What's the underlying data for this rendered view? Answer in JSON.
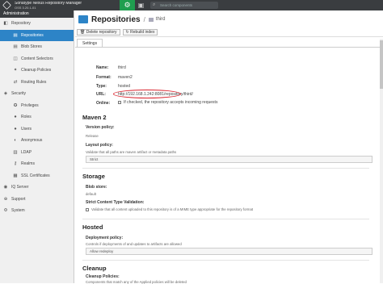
{
  "topbar": {
    "app_name": "Sonatype Nexus Repository Manager",
    "version": "OSS 3.20.1-01",
    "search_placeholder": "Search components",
    "icons": {
      "logo": "nexus-logo-icon",
      "admin": "gear-icon",
      "browse": "cube-icon",
      "search": "search-icon"
    }
  },
  "sidebar": {
    "header": "Administration",
    "items": [
      {
        "label": "Repository",
        "icon": "database-icon",
        "level": 0,
        "expander": "▾"
      },
      {
        "label": "Repositories",
        "icon": "database-icon",
        "level": 1,
        "selected": true
      },
      {
        "label": "Blob Stores",
        "icon": "database-icon",
        "level": 1
      },
      {
        "label": "Content Selectors",
        "icon": "layers-icon",
        "level": 1
      },
      {
        "label": "Cleanup Policies",
        "icon": "broom-icon",
        "level": 1
      },
      {
        "label": "Routing Rules",
        "icon": "route-icon",
        "level": 1
      },
      {
        "label": "Security",
        "icon": "shield-icon",
        "level": 0,
        "expander": "▾"
      },
      {
        "label": "Privileges",
        "icon": "badge-icon",
        "level": 1
      },
      {
        "label": "Roles",
        "icon": "user-role-icon",
        "level": 1
      },
      {
        "label": "Users",
        "icon": "users-icon",
        "level": 1
      },
      {
        "label": "Anonymous",
        "icon": "user-secret-icon",
        "level": 1
      },
      {
        "label": "LDAP",
        "icon": "book-icon",
        "level": 1
      },
      {
        "label": "Realms",
        "icon": "key-icon",
        "level": 1
      },
      {
        "label": "SSL Certificates",
        "icon": "certificate-icon",
        "level": 1
      },
      {
        "label": "IQ Server",
        "icon": "iq-icon",
        "level": 0
      },
      {
        "label": "Support",
        "icon": "support-icon",
        "level": 0,
        "expander": "▸"
      },
      {
        "label": "System",
        "icon": "system-icon",
        "level": 0,
        "expander": "▸"
      }
    ]
  },
  "main": {
    "title": "Repositories",
    "breadcrumb": "third",
    "toolbar": {
      "delete_label": "Delete repository",
      "rebuild_label": "Rebuild index"
    },
    "tab": "Settings",
    "summary": {
      "name_label": "Name:",
      "name_value": "third",
      "format_label": "Format:",
      "format_value": "maven2",
      "type_label": "Type:",
      "type_value": "hosted",
      "url_label": "URL:",
      "url_value": "http://192.168.1.242:8081/repository/third/",
      "online_label": "Online:",
      "online_desc": "If checked, the repository accepts incoming requests"
    },
    "maven": {
      "heading": "Maven 2",
      "version_policy_label": "Version policy:",
      "version_policy_value": "Release",
      "layout_policy_label": "Layout policy:",
      "layout_policy_desc": "Validate that all paths are maven artifact or metadata paths",
      "layout_policy_value": "Strict"
    },
    "storage": {
      "heading": "Storage",
      "blob_store_label": "Blob store:",
      "blob_store_value": "default",
      "strict_ct_label": "Strict Content Type Validation:",
      "strict_ct_desc": "Validate that all content uploaded to this repository is of a MIME type appropriate for the repository format"
    },
    "hosted": {
      "heading": "Hosted",
      "deployment_label": "Deployment policy:",
      "deployment_desc": "Controls if deployments of and updates to artifacts are allowed",
      "deployment_value": "Allow redeploy"
    },
    "cleanup": {
      "heading": "Cleanup",
      "policies_label": "Cleanup Policies:",
      "policies_desc": "Components that match any of the Applied policies will be deleted"
    }
  },
  "colors": {
    "accent": "#2d84c7",
    "admin_active": "#1f9e4f",
    "topbar": "#3a3d40",
    "highlight_ring": "#d9232d"
  }
}
